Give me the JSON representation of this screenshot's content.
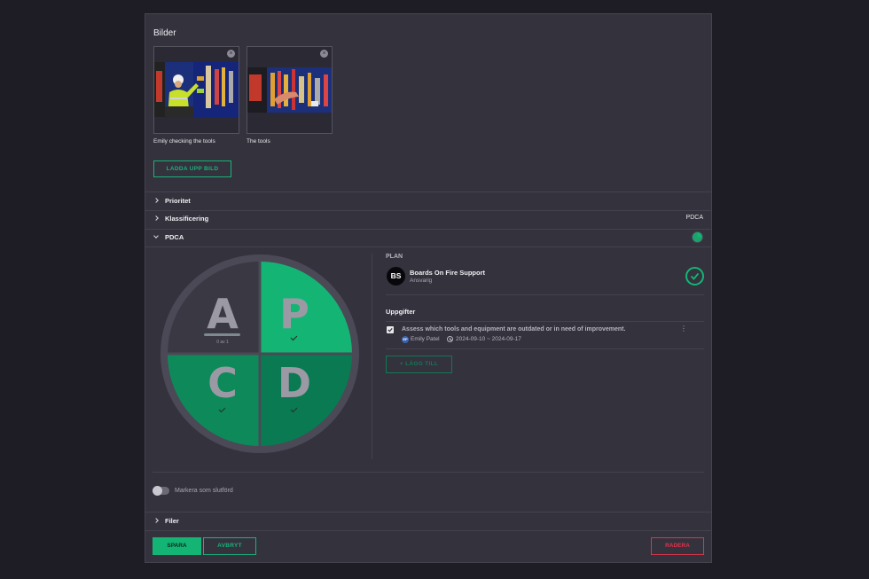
{
  "bilder": {
    "title": "Bilder",
    "images": [
      {
        "caption": "Emily checking the tools",
        "close_icon": "close-icon"
      },
      {
        "caption": "The tools",
        "close_icon": "close-icon"
      }
    ],
    "upload_label": "LADDA UPP BILD"
  },
  "sections": {
    "prioritet": "Prioritet",
    "klassificering": "Klassificering",
    "klassificering_value": "PDCA",
    "pdca": "PDCA",
    "filer": "Filer"
  },
  "pdca": {
    "quadrants": [
      {
        "letter": "A",
        "done": false,
        "progress_text": "0 av 1"
      },
      {
        "letter": "P",
        "done": true
      },
      {
        "letter": "C",
        "done": true
      },
      {
        "letter": "D",
        "done": true
      }
    ],
    "phase_label": "PLAN",
    "responsible": {
      "initials": "BS",
      "name": "Boards On Fire Support",
      "role": "Ansvarig"
    },
    "tasks_title": "Uppgifter",
    "tasks": [
      {
        "text": "Assess which tools and equipment are outdated or in need of improvement.",
        "checked": true,
        "assignee_initials": "EP",
        "assignee": "Emily Patel",
        "dates": "2024-09-10 ~ 2024-09-17"
      }
    ],
    "add_label": "+ LÄGG TILL"
  },
  "complete_toggle": {
    "label": "Markera som slutförd",
    "on": false
  },
  "footer": {
    "save_label": "SPARA",
    "cancel_label": "AVBRYT",
    "delete_label": "RADERA"
  },
  "colors": {
    "accent": "#14b574",
    "danger": "#e0344c",
    "panel": "#33323d",
    "background": "#1e1d26"
  }
}
